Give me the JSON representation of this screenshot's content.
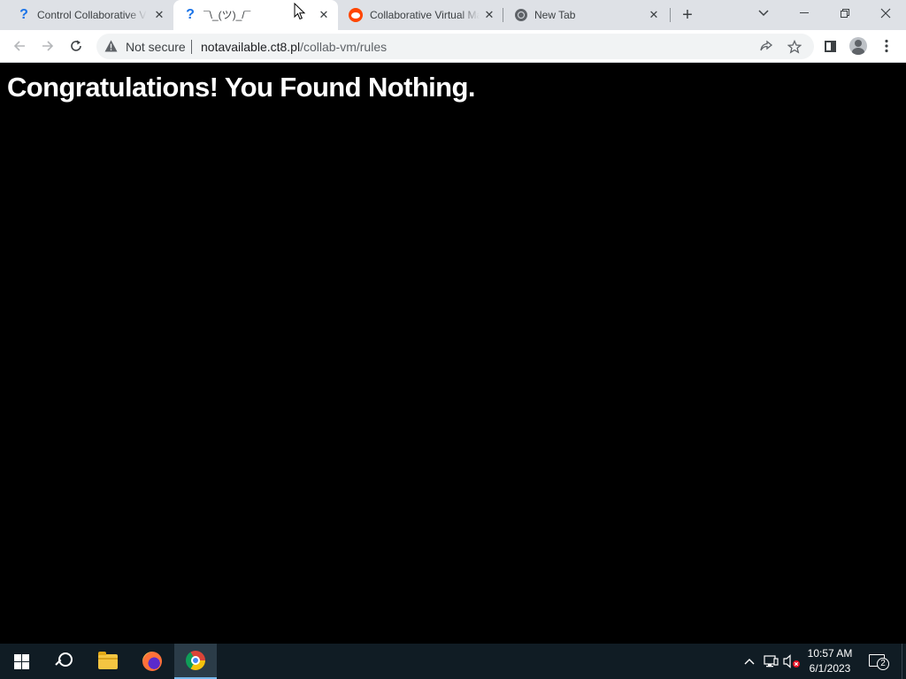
{
  "browser": {
    "tabs": [
      {
        "title": "Control Collaborative Virtual Machines",
        "icon": "question-icon",
        "active": false
      },
      {
        "title": "¯\\_(ツ)_/¯",
        "icon": "question-icon",
        "active": true
      },
      {
        "title": "Collaborative Virtual Machines",
        "icon": "reddit-icon",
        "active": false
      },
      {
        "title": "New Tab",
        "icon": "chrome-icon",
        "active": false
      }
    ],
    "new_tab_label": "+",
    "security_label": "Not secure",
    "url_host": "notavailable.ct8.pl",
    "url_path": "/collab-vm/rules"
  },
  "page": {
    "heading": "Congratulations! You Found Nothing."
  },
  "taskbar": {
    "apps": [
      "start-icon",
      "search-icon",
      "file-explorer-icon",
      "firefox-icon",
      "chrome-icon"
    ],
    "active_app": "chrome-icon",
    "time": "10:57 AM",
    "date": "6/1/2023",
    "notification_count": "2"
  },
  "colors": {
    "page_background": "#000000",
    "heading_text": "#ffffff",
    "tabstrip": "#dee1e6",
    "taskbar": "#101c24"
  }
}
